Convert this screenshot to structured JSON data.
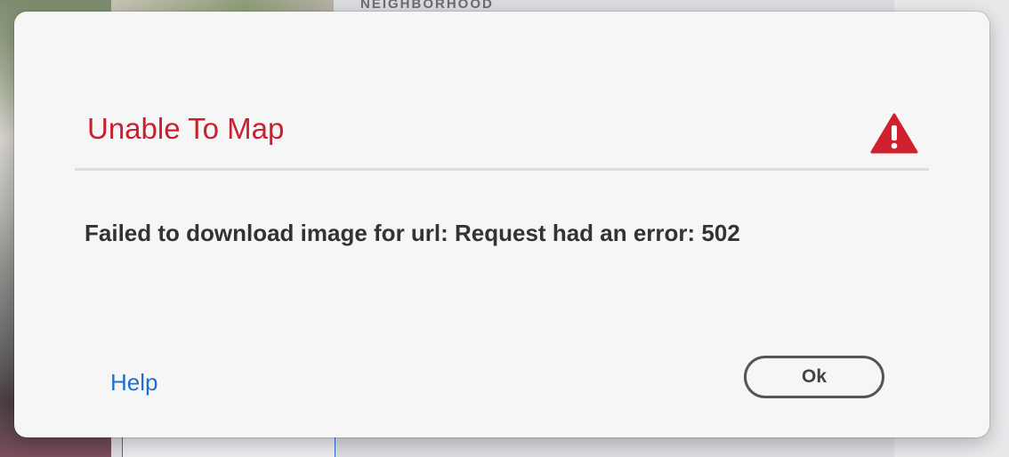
{
  "background": {
    "section_heading": "NEIGHBORHOOD"
  },
  "dialog": {
    "title": "Unable To Map",
    "title_color": "#c8202f",
    "icon": "warning-icon",
    "message": "Failed to download image for url: Request had an error: 502",
    "help_label": "Help",
    "ok_label": "Ok",
    "link_color": "#1f6fce"
  }
}
